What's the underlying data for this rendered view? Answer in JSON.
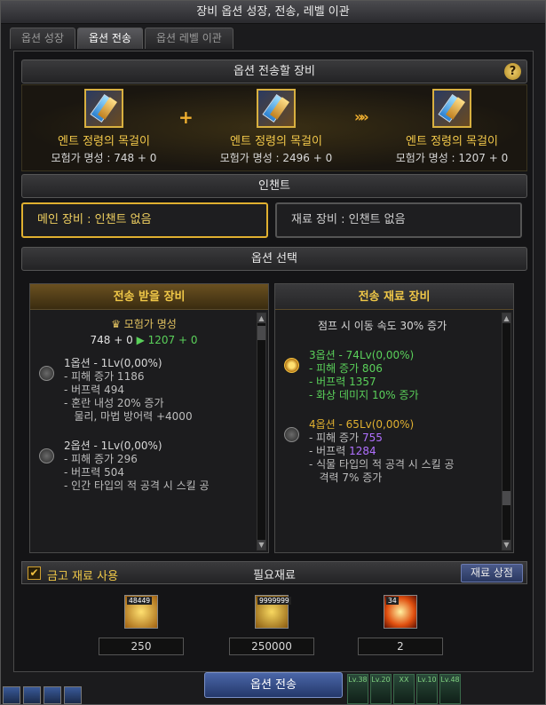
{
  "window": {
    "title": "장비 옵션 성장, 전송, 레벨 이관"
  },
  "tabs": [
    {
      "label": "옵션 성장",
      "active": false
    },
    {
      "label": "옵션 전송",
      "active": true
    },
    {
      "label": "옵션 레벨 이관",
      "active": false
    }
  ],
  "transfer_section": {
    "title": "옵션 전송할 장비",
    "help": "?",
    "items": [
      {
        "name": "엔트 정령의 목걸이",
        "fame": "모험가 명성 : 748 + 0",
        "icon": "necklace-icon"
      },
      {
        "name": "엔트 정령의 목걸이",
        "fame": "모험가 명성 : 2496 + 0",
        "icon": "necklace-icon"
      },
      {
        "name": "엔트 정령의 목걸이",
        "fame": "모험가 명성 : 1207 + 0",
        "icon": "necklace-icon"
      }
    ],
    "plus": "+",
    "arrow": "»»"
  },
  "enchant_section": {
    "title": "인챈트",
    "main": "메인 장비 : 인챈트 없음",
    "sub": "재료 장비 : 인챈트 없음"
  },
  "option_section": {
    "title": "옵션 선택",
    "left": {
      "header": "전송 받을 장비",
      "fame_title": "모험가 명성",
      "fame_before": "748 + 0",
      "fame_arrow": "▶",
      "fame_after": "1207 + 0",
      "options": [
        {
          "title": "1옵션 - 1Lv(0,00%)",
          "lines": [
            "- 피해 증가 1186",
            "- 버프력 494",
            "- 혼란 내성 20% 증가",
            "   물리, 마법 방어력 +4000"
          ],
          "selected": false
        },
        {
          "title": "2옵션 - 1Lv(0,00%)",
          "lines": [
            "- 피해 증가 296",
            "- 버프력 504",
            "- 인간 타입의 적 공격 시 스킬 공"
          ],
          "selected": false
        }
      ]
    },
    "right": {
      "header": "전송 재료 장비",
      "top_line": "점프 시 이동 속도 30% 증가",
      "options": [
        {
          "title": "3옵션 - 74Lv(0,00%)",
          "lines": [
            "- 피해 증가 806",
            "- 버프력 1357",
            "- 화상 데미지 10% 증가"
          ],
          "selected": true
        },
        {
          "title": "4옵션 - 65Lv(0,00%)",
          "line1_prefix": "- 피해 증가 ",
          "line1_value": "755",
          "line2_prefix": "- 버프력 ",
          "line2_value": "1284",
          "line3": "- 식물 타입의 적 공격 시 스킬 공",
          "line4": "   격력 7% 증가",
          "selected": false
        }
      ]
    }
  },
  "materials": {
    "checkbox_label": "금고 재료 사용",
    "checkbox_checked": true,
    "check_mark": "✔",
    "title": "필요재료",
    "shop_button": "재료 상점",
    "items": [
      {
        "icon": "gold-gem-icon",
        "tag": "48449",
        "count": "250"
      },
      {
        "icon": "gold-coins-icon",
        "tag": "9999999",
        "count": "250000"
      },
      {
        "icon": "fire-orb-icon",
        "tag": "34",
        "count": "2"
      }
    ]
  },
  "footer": {
    "transfer_button": "옵션 전송"
  },
  "hud": {
    "levels": [
      "Lv.38",
      "Lv.20",
      "Lv.10",
      "Lv.48"
    ],
    "marks": "XX"
  }
}
